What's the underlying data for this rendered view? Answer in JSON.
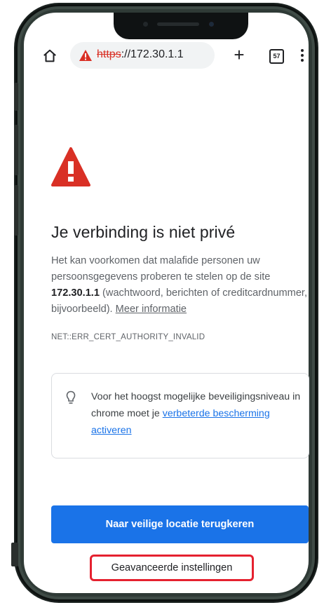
{
  "browser": {
    "url_scheme": "https",
    "url_rest": "://172.30.1.1",
    "tab_count": "57",
    "icons": {
      "home": "home-icon",
      "security": "not-secure-warning-icon",
      "new_tab": "plus-icon",
      "tabs": "tab-switcher-icon",
      "menu": "more-vert-icon"
    }
  },
  "page": {
    "heading": "Je verbinding is niet privé",
    "paragraph_before_host": "Het kan voorkomen dat malafide personen uw persoonsgegevens proberen te stelen op de site ",
    "host": "172.30.1.1",
    "paragraph_after_host": " (wachtwoord, berichten of creditcardnummer, bijvoorbeeld). ",
    "more_info_link": "Meer informatie",
    "error_code": "NET::ERR_CERT_AUTHORITY_INVALID",
    "info_box_text": "Voor het hoogst mogelijke beveiligingsniveau in chrome moet je ",
    "info_box_link": "verbeterde bescherming activeren",
    "back_button": "Naar veilige locatie terugkeren",
    "advanced_button": "Geavanceerde instellingen"
  },
  "colors": {
    "accent": "#1a73e8",
    "warning_red": "#d93025",
    "highlight_border": "#e5212f",
    "phone_frame": "#2f3a36"
  }
}
